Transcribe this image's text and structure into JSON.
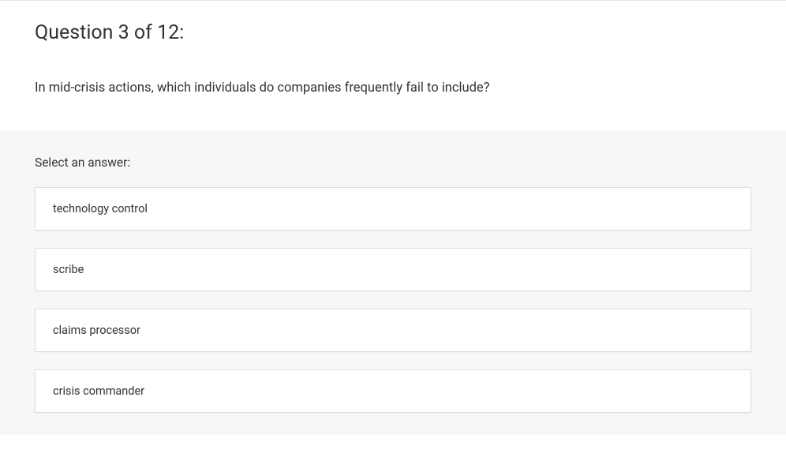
{
  "question": {
    "header": "Question 3 of 12:",
    "text": "In mid-crisis actions, which individuals do companies frequently fail to include?"
  },
  "answers": {
    "prompt": "Select an answer:",
    "options": [
      {
        "label": "technology control"
      },
      {
        "label": "scribe"
      },
      {
        "label": "claims processor"
      },
      {
        "label": "crisis commander"
      }
    ]
  }
}
